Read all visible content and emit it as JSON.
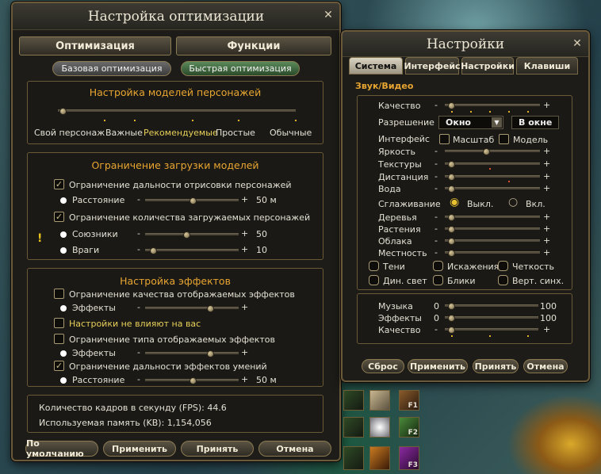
{
  "opt": {
    "title": "Настройка оптимизации",
    "tab_opt": "Оптимизация",
    "tab_func": "Функции",
    "sub_basic": "Базовая оптимизация",
    "sub_fast": "Быстрая оптимизация",
    "models": {
      "title": "Настройка моделей персонажей",
      "labels": [
        "Свой персонаж",
        "Важные",
        "Рекомендуемые",
        "Простые",
        "Обычные"
      ],
      "selected": "Рекомендуемые"
    },
    "limits": {
      "title": "Ограничение загрузки моделей",
      "draw_limit": "Ограничение дальности отрисовки персонажей",
      "distance": "Расстояние",
      "distance_val": "50 м",
      "count_limit": "Ограничение количества загружаемых персонажей",
      "allies": "Союзники",
      "allies_val": "50",
      "enemies": "Враги",
      "enemies_val": "10"
    },
    "effects": {
      "title": "Настройка эффектов",
      "quality_limit": "Ограничение качества отображаемых эффектов",
      "effects": "Эффекты",
      "no_affect": "Настройки не влияют на вас",
      "type_limit": "Ограничение типа отображаемых эффектов",
      "effects2": "Эффекты",
      "skill_limit": "Ограничение дальности эффектов умений",
      "distance": "Расстояние",
      "distance_val": "50 м"
    },
    "fps": "Количество кадров в секунду (FPS):  44.6",
    "memory": "Используемая память (KB):  1,154,056",
    "btn_default": "По умолчанию",
    "btn_apply": "Применить",
    "btn_ok": "Принять",
    "btn_cancel": "Отмена"
  },
  "settings": {
    "title": "Настройки",
    "tabs": [
      "Система",
      "Интерфейс",
      "Настройки",
      "Клавиши"
    ],
    "section": "Звук/Видео",
    "quality": "Качество",
    "resolution": "Разрешение",
    "resolution_mode": "Окно",
    "resolution_value": "В окне",
    "interface": "Интерфейс",
    "scale": "Масштаб",
    "model": "Модель",
    "brightness": "Яркость",
    "textures": "Текстуры",
    "distance": "Дистанция",
    "water": "Вода",
    "smoothing": "Сглаживание",
    "off": "Выкл.",
    "on": "Вкл.",
    "trees": "Деревья",
    "plants": "Растения",
    "clouds": "Облака",
    "terrain": "Местность",
    "shadows": "Тени",
    "distortion": "Искажения",
    "sharpness": "Четкость",
    "dyn_light": "Дин. свет",
    "glare": "Блики",
    "vsync": "Верт. синх.",
    "music": "Музыка",
    "effects": "Эффекты",
    "quality2": "Качество",
    "min": "0",
    "max": "100",
    "btn_reset": "Сброс",
    "btn_apply": "Применить",
    "btn_ok": "Принять",
    "btn_cancel": "Отмена"
  },
  "hotkeys": [
    "F1",
    "F2",
    "F3"
  ],
  "colors": {
    "accent": "#e8a531",
    "panel": "#1a1915",
    "border": "#6a5a36"
  }
}
